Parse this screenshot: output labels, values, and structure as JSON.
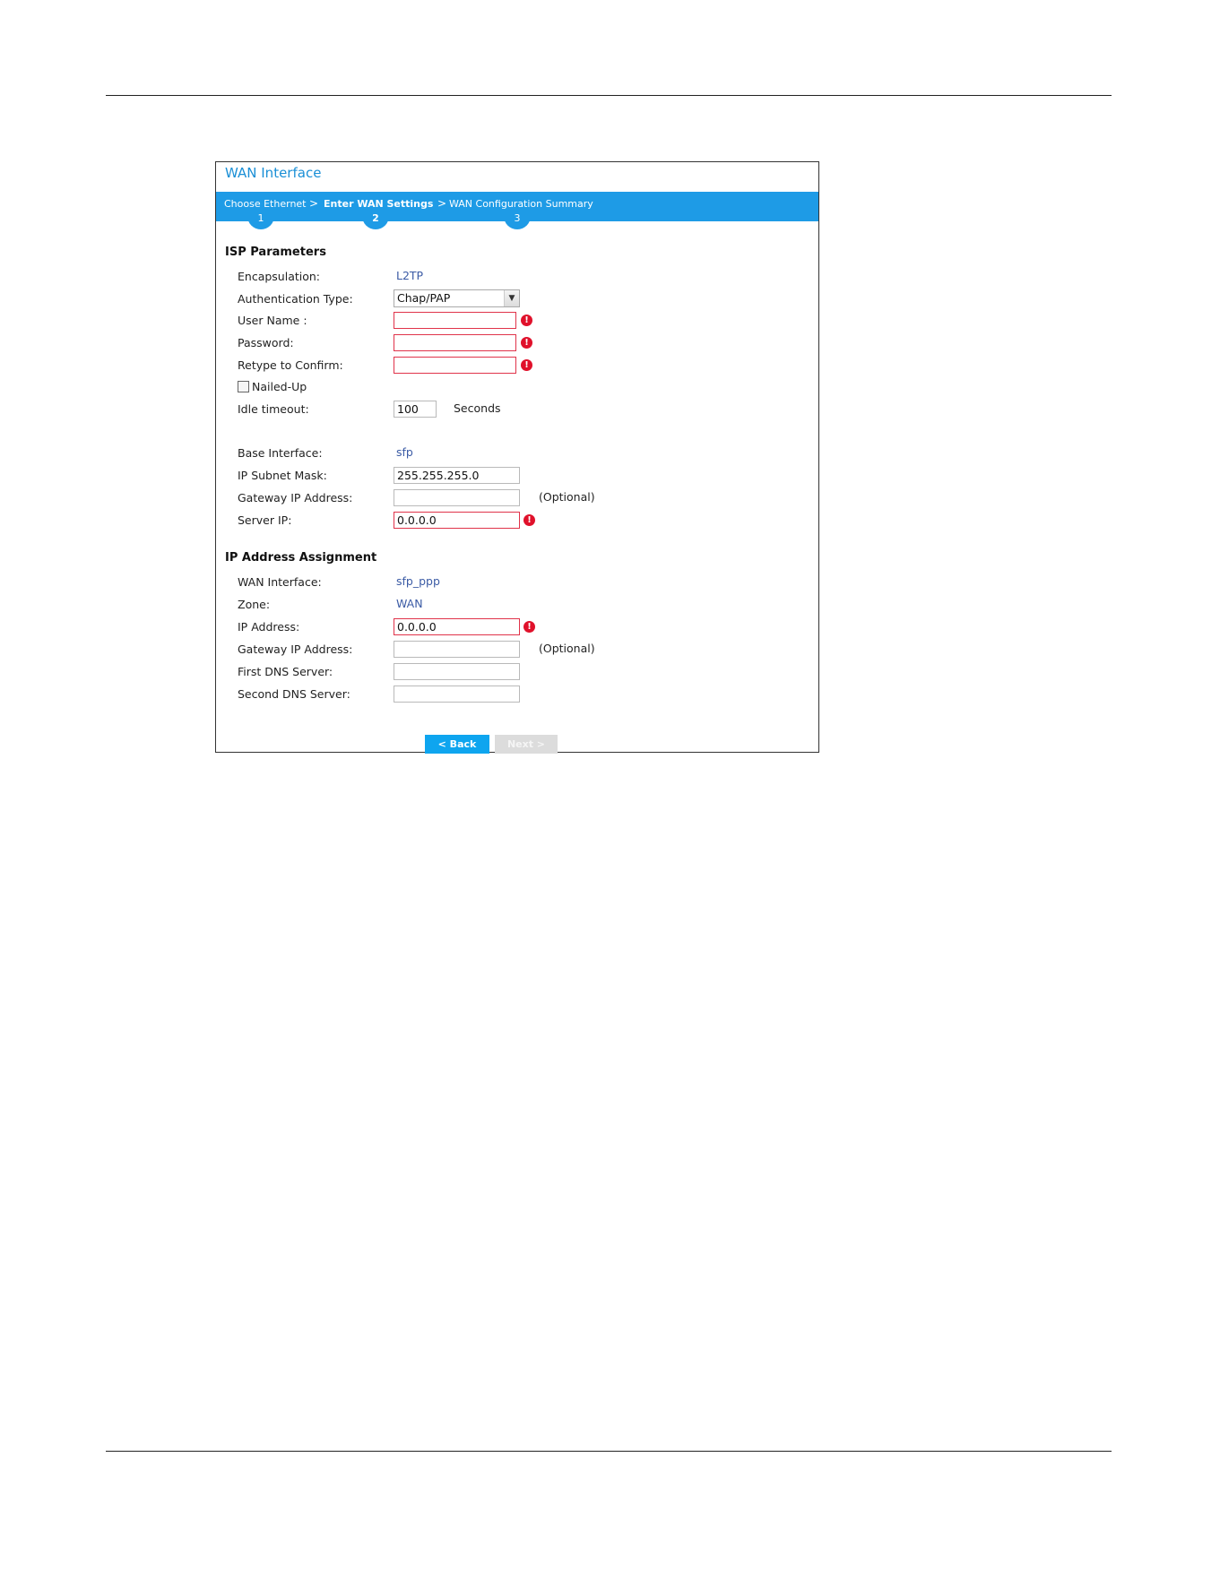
{
  "panel": {
    "title": "WAN Interface"
  },
  "wizard": {
    "steps": [
      {
        "label": "Choose Ethernet",
        "number": "1",
        "active": false
      },
      {
        "label": "Enter WAN Settings",
        "number": "2",
        "active": true
      },
      {
        "label": "WAN Configuration Summary",
        "number": "3",
        "active": false
      }
    ],
    "separator": ">"
  },
  "isp": {
    "title": "ISP Parameters",
    "encapsulation_label": "Encapsulation:",
    "encapsulation_value": "L2TP",
    "auth_label": "Authentication Type:",
    "auth_value": "Chap/PAP",
    "username_label": "User Name :",
    "username_value": "",
    "password_label": "Password:",
    "password_value": "",
    "retype_label": "Retype to Confirm:",
    "retype_value": "",
    "nailed_label": "Nailed-Up",
    "nailed_checked": false,
    "idle_label": "Idle timeout:",
    "idle_value": "100",
    "idle_unit": "Seconds",
    "base_label": "Base Interface:",
    "base_value": "sfp",
    "subnet_label": "IP Subnet Mask:",
    "subnet_value": "255.255.255.0",
    "gateway_label": "Gateway IP Address:",
    "gateway_value": "",
    "gateway_optional": "(Optional)",
    "server_label": "Server IP:",
    "server_value": "0.0.0.0"
  },
  "assign": {
    "title": "IP Address Assignment",
    "wan_label": "WAN Interface:",
    "wan_value": "sfp_ppp",
    "zone_label": "Zone:",
    "zone_value": "WAN",
    "ip_label": "IP Address:",
    "ip_value": "0.0.0.0",
    "gateway_label": "Gateway IP Address:",
    "gateway_value": "",
    "gateway_optional": "(Optional)",
    "dns1_label": "First DNS Server:",
    "dns1_value": "",
    "dns2_label": "Second DNS Server:",
    "dns2_value": ""
  },
  "buttons": {
    "back": "< Back",
    "next": "Next >"
  },
  "icons": {
    "error": "error-icon",
    "dropdown": "chevron-down-icon"
  },
  "colors": {
    "accent": "#1e9be6",
    "error": "#e0112b",
    "value_text": "#3b5ba5"
  }
}
